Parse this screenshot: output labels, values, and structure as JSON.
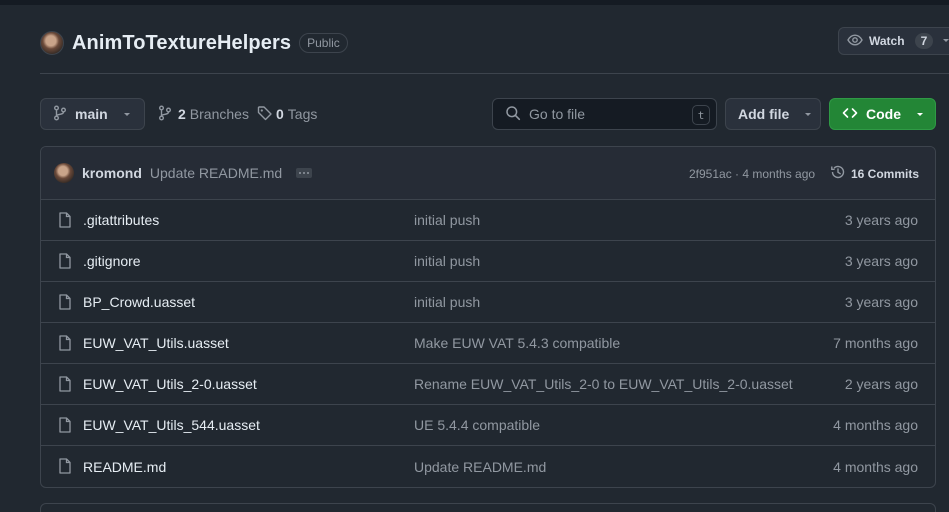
{
  "repo": {
    "name": "AnimToTextureHelpers",
    "visibility": "Public"
  },
  "watch": {
    "label": "Watch",
    "count": "7"
  },
  "toolbar": {
    "branch": "main",
    "branches_count": "2",
    "branches_label": "Branches",
    "tags_count": "0",
    "tags_label": "Tags",
    "goto_placeholder": "Go to file",
    "goto_shortcut": "t",
    "add_file_label": "Add file",
    "code_label": "Code"
  },
  "latest_commit": {
    "user": "kromond",
    "message": "Update README.md",
    "meta": "2f951ac · 4 months ago",
    "commits_label": "16 Commits"
  },
  "files": [
    {
      "name": ".gitattributes",
      "message": "initial push",
      "age": "3 years ago"
    },
    {
      "name": ".gitignore",
      "message": "initial push",
      "age": "3 years ago"
    },
    {
      "name": "BP_Crowd.uasset",
      "message": "initial push",
      "age": "3 years ago"
    },
    {
      "name": "EUW_VAT_Utils.uasset",
      "message": "Make EUW VAT 5.4.3 compatible",
      "age": "7 months ago"
    },
    {
      "name": "EUW_VAT_Utils_2-0.uasset",
      "message": "Rename EUW_VAT_Utils_2-0 to EUW_VAT_Utils_2-0.uasset",
      "age": "2 years ago"
    },
    {
      "name": "EUW_VAT_Utils_544.uasset",
      "message": "UE 5.4.4 compatible",
      "age": "4 months ago"
    },
    {
      "name": "README.md",
      "message": "Update README.md",
      "age": "4 months ago"
    }
  ],
  "colors": {
    "background": "#212830",
    "border": "#3d444d",
    "code_button": "#238636",
    "muted_text": "#9198a1"
  }
}
